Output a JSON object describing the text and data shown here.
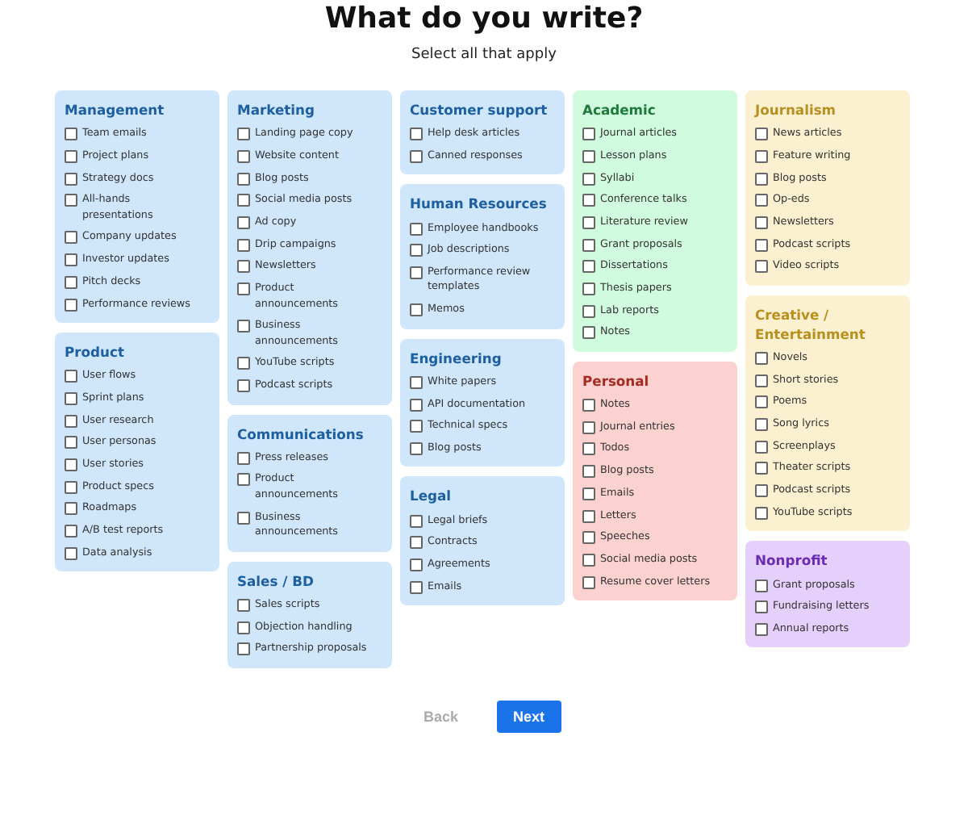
{
  "title": "What do you write?",
  "subtitle": "Select all that apply",
  "columns": [
    {
      "categories": [
        {
          "name": "Management",
          "color": "#1d5fa0",
          "items": [
            {
              "label": "Team emails",
              "checked": false
            },
            {
              "label": "Project plans",
              "checked": false
            },
            {
              "label": "Strategy docs",
              "checked": false
            },
            {
              "label": "All-hands presentations",
              "checked": false
            },
            {
              "label": "Company updates",
              "checked": false
            },
            {
              "label": "Investor updates",
              "checked": false
            },
            {
              "label": "Pitch decks",
              "checked": false
            },
            {
              "label": "Performance reviews",
              "checked": false
            }
          ]
        },
        {
          "name": "Product",
          "color": "#1d5fa0",
          "items": [
            {
              "label": "User flows",
              "checked": false
            },
            {
              "label": "Sprint plans",
              "checked": false
            },
            {
              "label": "User research",
              "checked": false
            },
            {
              "label": "User personas",
              "checked": false
            },
            {
              "label": "User stories",
              "checked": false
            },
            {
              "label": "Product specs",
              "checked": false
            },
            {
              "label": "Roadmaps",
              "checked": false
            },
            {
              "label": "A/B test reports",
              "checked": false
            },
            {
              "label": "Data analysis",
              "checked": false
            }
          ]
        }
      ]
    },
    {
      "categories": [
        {
          "name": "Marketing",
          "color": "#1d5fa0",
          "items": [
            {
              "label": "Landing page copy",
              "checked": false
            },
            {
              "label": "Website content",
              "checked": false
            },
            {
              "label": "Blog posts",
              "checked": false
            },
            {
              "label": "Social media posts",
              "checked": false
            },
            {
              "label": "Ad copy",
              "checked": false
            },
            {
              "label": "Drip campaigns",
              "checked": false
            },
            {
              "label": "Newsletters",
              "checked": false
            },
            {
              "label": "Product announcements",
              "checked": false
            },
            {
              "label": "Business announcements",
              "checked": false
            },
            {
              "label": "YouTube scripts",
              "checked": false
            },
            {
              "label": "Podcast scripts",
              "checked": false
            }
          ]
        },
        {
          "name": "Communications",
          "color": "#1d5fa0",
          "items": [
            {
              "label": "Press releases",
              "checked": false
            },
            {
              "label": "Product announcements",
              "checked": false
            },
            {
              "label": "Business announcements",
              "checked": false
            }
          ]
        },
        {
          "name": "Sales / BD",
          "color": "#1d5fa0",
          "items": [
            {
              "label": "Sales scripts",
              "checked": false
            },
            {
              "label": "Objection handling",
              "checked": false
            },
            {
              "label": "Partnership proposals",
              "checked": false
            }
          ]
        }
      ]
    },
    {
      "categories": [
        {
          "name": "Customer support",
          "color": "#1d5fa0",
          "items": [
            {
              "label": "Help desk articles",
              "checked": false
            },
            {
              "label": "Canned responses",
              "checked": false
            }
          ]
        },
        {
          "name": "Human Resources",
          "color": "#1d5fa0",
          "items": [
            {
              "label": "Employee handbooks",
              "checked": false
            },
            {
              "label": "Job descriptions",
              "checked": false
            },
            {
              "label": "Performance review templates",
              "checked": false
            },
            {
              "label": "Memos",
              "checked": false
            }
          ]
        },
        {
          "name": "Engineering",
          "color": "#1d5fa0",
          "items": [
            {
              "label": "White papers",
              "checked": false
            },
            {
              "label": "API documentation",
              "checked": false
            },
            {
              "label": "Technical specs",
              "checked": false
            },
            {
              "label": "Blog posts",
              "checked": false
            }
          ]
        },
        {
          "name": "Legal",
          "color": "#1d5fa0",
          "items": [
            {
              "label": "Legal briefs",
              "checked": false
            },
            {
              "label": "Contracts",
              "checked": false
            },
            {
              "label": "Agreements",
              "checked": false
            },
            {
              "label": "Emails",
              "checked": false
            }
          ]
        }
      ]
    },
    {
      "categories": [
        {
          "name": "Academic",
          "color": "#1e7a3c",
          "items": [
            {
              "label": "Journal articles",
              "checked": false
            },
            {
              "label": "Lesson plans",
              "checked": false
            },
            {
              "label": "Syllabi",
              "checked": false
            },
            {
              "label": "Conference talks",
              "checked": false
            },
            {
              "label": "Literature review",
              "checked": false
            },
            {
              "label": "Grant proposals",
              "checked": false
            },
            {
              "label": "Dissertations",
              "checked": false
            },
            {
              "label": "Thesis papers",
              "checked": false
            },
            {
              "label": "Lab reports",
              "checked": false
            },
            {
              "label": "Notes",
              "checked": false
            }
          ]
        },
        {
          "name": "Personal",
          "color": "#a52a22",
          "items": [
            {
              "label": "Notes",
              "checked": false
            },
            {
              "label": "Journal entries",
              "checked": false
            },
            {
              "label": "Todos",
              "checked": false
            },
            {
              "label": "Blog posts",
              "checked": false
            },
            {
              "label": "Emails",
              "checked": false
            },
            {
              "label": "Letters",
              "checked": false
            },
            {
              "label": "Speeches",
              "checked": false
            },
            {
              "label": "Social media posts",
              "checked": false
            },
            {
              "label": "Resume cover letters",
              "checked": false
            }
          ]
        }
      ]
    },
    {
      "categories": [
        {
          "name": "Journalism",
          "color": "#b8901f",
          "items": [
            {
              "label": "News articles",
              "checked": false
            },
            {
              "label": "Feature writing",
              "checked": false
            },
            {
              "label": "Blog posts",
              "checked": false
            },
            {
              "label": "Op-eds",
              "checked": false
            },
            {
              "label": "Newsletters",
              "checked": false
            },
            {
              "label": "Podcast scripts",
              "checked": false
            },
            {
              "label": "Video scripts",
              "checked": false
            }
          ]
        },
        {
          "name": "Creative / Entertainment",
          "color": "#b8901f",
          "items": [
            {
              "label": "Novels",
              "checked": false
            },
            {
              "label": "Short stories",
              "checked": false
            },
            {
              "label": "Poems",
              "checked": false
            },
            {
              "label": "Song lyrics",
              "checked": false
            },
            {
              "label": "Screenplays",
              "checked": false
            },
            {
              "label": "Theater scripts",
              "checked": false
            },
            {
              "label": "Podcast scripts",
              "checked": false
            },
            {
              "label": "YouTube scripts",
              "checked": false
            }
          ]
        },
        {
          "name": "Nonprofit",
          "color": "#6b2bb4",
          "items": [
            {
              "label": "Grant proposals",
              "checked": false
            },
            {
              "label": "Fundraising letters",
              "checked": false
            },
            {
              "label": "Annual reports",
              "checked": false
            }
          ]
        }
      ]
    }
  ],
  "buttons": [
    {
      "label": "Back",
      "kind": "secondary",
      "disabled": true
    },
    {
      "label": "Next",
      "kind": "primary",
      "disabled": false
    }
  ]
}
